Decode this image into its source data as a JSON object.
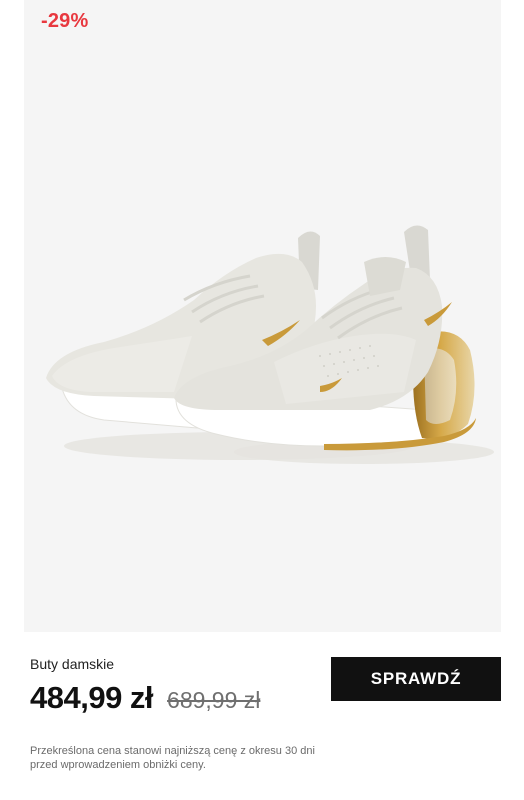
{
  "product": {
    "discount_badge": "-29%",
    "image_alt": "Buty damskie",
    "name": "Buty damskie",
    "price_current": "484,99 zł",
    "price_old": "689,99 zł",
    "cta_label": "SPRAWDŹ",
    "disclaimer": "Przekreślona cena stanowi najniższą cenę z okresu 30 dni przed wprowadzeniem obniżki ceny."
  },
  "colors": {
    "discount": "#e8383f",
    "cta_background": "#111111",
    "image_background": "#f5f5f5",
    "shoe_upper": "#e4e3dd",
    "shoe_accent": "#c99a3a"
  },
  "icons": {
    "product_image": "sneaker-image"
  }
}
